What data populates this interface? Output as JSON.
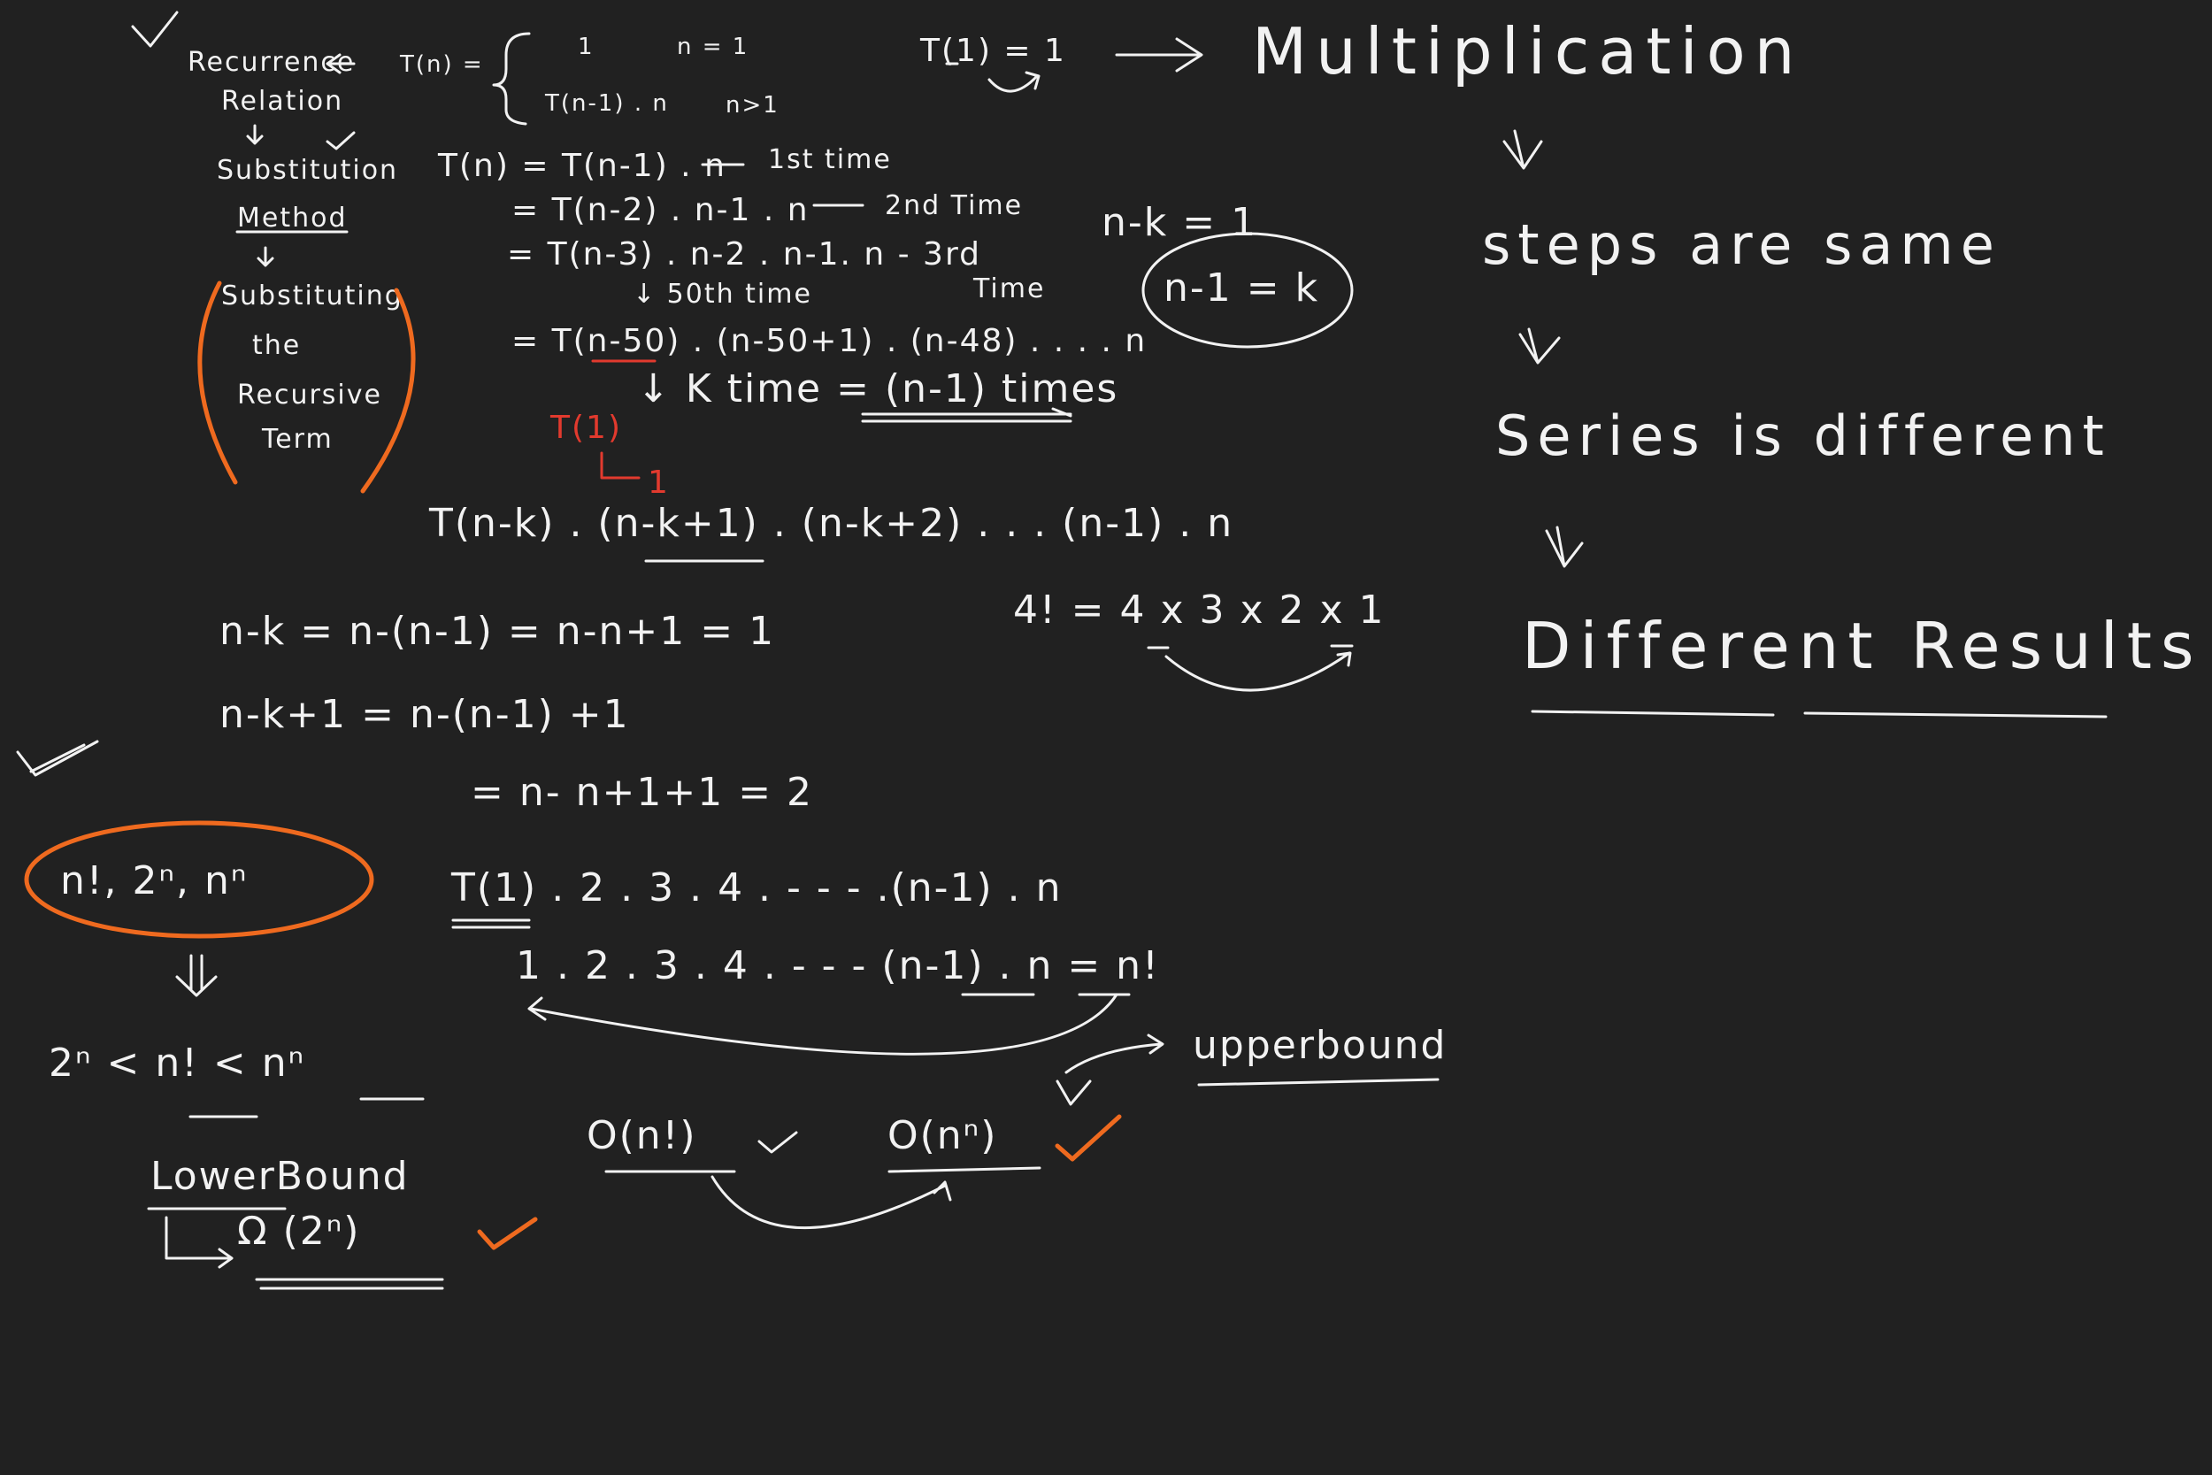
{
  "flow": {
    "recurrence": "Recurrence",
    "relation": "Relation",
    "substitution": "Substitution",
    "method": "Method",
    "substituting": "Substituting",
    "the": "the",
    "recursive": "Recursive",
    "term": "Term"
  },
  "definition": {
    "lhs": "T(n) =",
    "case1_value": "1",
    "case1_cond": "n = 1",
    "case2_value": "T(n-1) . n",
    "case2_cond": "n>1",
    "base": "T(1) = 1"
  },
  "steps": {
    "line1": "T(n) = T(n-1) . n",
    "line1_note": "1st time",
    "line2": "= T(n-2) . n-1 . n",
    "line2_note": "2nd Time",
    "line3": "= T(n-3) . n-2 . n-1. n - 3rd",
    "line3_time": "Time",
    "fiftieth": "↓ 50th time",
    "line4": "= T(n-50) . (n-50+1) . (n-48) . . . . n",
    "ktime": "↓ K time = (n-1) times",
    "t1": "T(1)",
    "t1_value": "1",
    "nk_eq": "n-k = 1",
    "n1k": "n-1 = k"
  },
  "general_term": "T(n-k) . (n-k+1) . (n-k+2) . . . (n-1) . n",
  "factorial_example": "4! = 4 x 3 x 2 x 1",
  "derivation": {
    "line1": "n-k = n-(n-1) = n-n+1 = 1",
    "line2": "n-k+1 = n-(n-1) +1",
    "line3": "= n- n+1+1 = 2"
  },
  "product": {
    "line1": "T(1) . 2 . 3 . 4 . - - - .(n-1) . n",
    "line2": "1 . 2 . 3 . 4 . - - - (n-1) . n = n!"
  },
  "bounds": {
    "circle_text": "n!, 2ⁿ, nⁿ",
    "inequality": "2ⁿ < n! < nⁿ",
    "lower_label": "LowerBound",
    "omega": "Ω (2ⁿ)",
    "big_o_fact": "O(n!)",
    "big_o_pow": "O(nⁿ)",
    "upper_label": "upperbound"
  },
  "right_notes": {
    "multiplication": "Multiplication",
    "steps_same": "steps are same",
    "series_diff": "Series is different",
    "diff_results": "Different Results"
  },
  "colors": {
    "background": "#212121",
    "ink": "#f2f2f2",
    "orange": "#ef6a1f",
    "red": "#e23a2e"
  }
}
